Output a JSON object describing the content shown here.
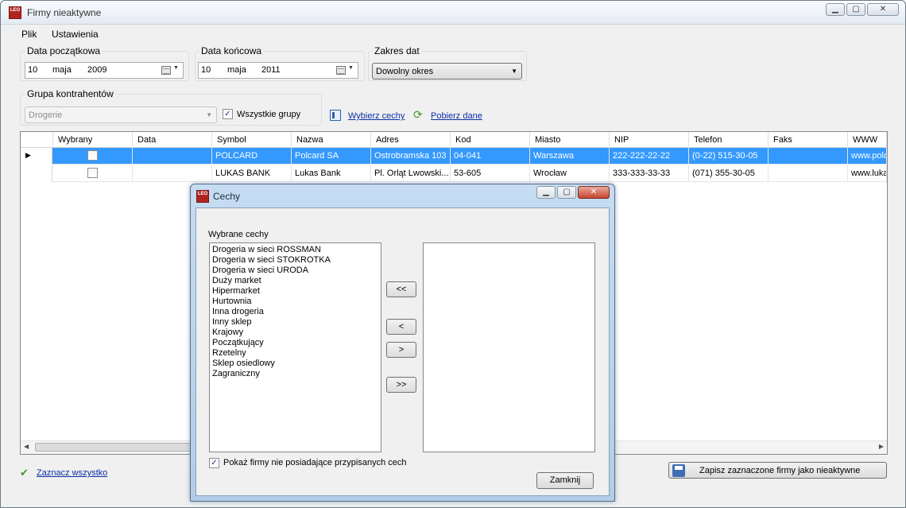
{
  "window": {
    "title": "Firmy nieaktywne",
    "logo_text": "LEO"
  },
  "menu": [
    "Plik",
    "Ustawienia"
  ],
  "date_start": {
    "label": "Data początkowa",
    "day": "10",
    "month": "maja",
    "year": "2009"
  },
  "date_end": {
    "label": "Data końcowa",
    "day": "10",
    "month": "maja",
    "year": "2011"
  },
  "date_range": {
    "label": "Zakres dat",
    "selected": "Dowolny okres"
  },
  "contractor_group": {
    "label": "Grupa kontrahentów",
    "selected": "Drogerie",
    "all_groups_label": "Wszystkie grupy",
    "all_groups_checked": true
  },
  "actions": {
    "select_features": "Wybierz cechy",
    "fetch_data": "Pobierz dane"
  },
  "grid": {
    "columns": [
      "Wybrany",
      "Data",
      "Symbol",
      "Nazwa",
      "Adres",
      "Kod",
      "Miasto",
      "NIP",
      "Telefon",
      "Faks",
      "WWW"
    ],
    "rows": [
      {
        "data": "",
        "symbol": "POLCARD",
        "nazwa": "Polcard SA",
        "adres": "Ostrobramska 103",
        "kod": "04-041",
        "miasto": "Warszawa",
        "nip": "222-222-22-22",
        "telefon": "(0-22) 515-30-05",
        "faks": "",
        "www": "www.polca",
        "selected": true
      },
      {
        "data": "",
        "symbol": "LUKAS BANK",
        "nazwa": "Lukas Bank",
        "adres": "Pl. Orląt Lwowski...",
        "kod": "53-605",
        "miasto": "Wrocław",
        "nip": "333-333-33-33",
        "telefon": "(071) 355-30-05",
        "faks": "",
        "www": "www.lukas",
        "selected": false
      }
    ]
  },
  "bottom": {
    "select_all": "Zaznacz wszystko",
    "save_button": "Zapisz zaznaczone firmy jako nieaktywne"
  },
  "dialog": {
    "title": "Cechy",
    "list_label": "Wybrane cechy",
    "available": [
      "Drogeria w sieci ROSSMAN",
      "Drogeria w sieci STOKROTKA",
      "Drogeria w sieci URODA",
      "Duży market",
      "Hipermarket",
      "Hurtownia",
      "Inna drogeria",
      "Inny sklep",
      "Krajowy",
      "Początkujący",
      "Rzetelny",
      "Sklep osiedlowy",
      "Zagraniczny"
    ],
    "selected": [],
    "btn_remove_all": "<<",
    "btn_remove": "<",
    "btn_add": ">",
    "btn_add_all": ">>",
    "show_without_label": "Pokaż firmy nie posiadające przypisanych cech",
    "show_without_checked": true,
    "close_button": "Zamknij"
  },
  "colors": {
    "selection": "#3399ff",
    "link": "#0a2fa6",
    "logo": "#b1241e"
  }
}
